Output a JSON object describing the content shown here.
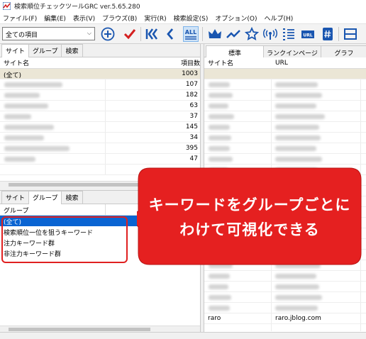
{
  "window": {
    "title": "検索順位チェックツールGRC  ver.5.65.280"
  },
  "menu": [
    "ファイル(F)",
    "編集(E)",
    "表示(V)",
    "ブラウズ(B)",
    "実行(R)",
    "検索設定(S)",
    "オプション(O)",
    "ヘルプ(H)"
  ],
  "toolbar": {
    "filter_value": "全ての項目",
    "all_label": "ALL",
    "url_label": "URL"
  },
  "site_panel": {
    "tabs": [
      "サイト",
      "グループ",
      "検索"
    ],
    "col_site": "サイト名",
    "col_items": "項目数",
    "rows": [
      {
        "name": "(全て)",
        "count": "1003"
      },
      {
        "name": "",
        "count": "107"
      },
      {
        "name": "",
        "count": "182"
      },
      {
        "name": "",
        "count": "63"
      },
      {
        "name": "",
        "count": "37"
      },
      {
        "name": "",
        "count": "145"
      },
      {
        "name": "",
        "count": "34"
      },
      {
        "name": "",
        "count": "395"
      },
      {
        "name": "",
        "count": "47"
      }
    ]
  },
  "group_panel": {
    "tabs": [
      "サイト",
      "グループ",
      "検索"
    ],
    "col_group": "グループ",
    "rows": [
      "(全て)",
      "検索順位一位を狙うキーワード",
      "注力キーワード群",
      "非注力キーワード群"
    ]
  },
  "right_panel": {
    "tabs": [
      "標準",
      "ランクインページ",
      "グラフ"
    ],
    "col_site": "サイト名",
    "col_url": "URL",
    "last_row_site": "raro",
    "last_row_url": "raro.jblog.com"
  },
  "annotation": {
    "line1": "キーワードをグループごとに",
    "line2": "わけて可視化できる",
    "color": "#e52020"
  }
}
